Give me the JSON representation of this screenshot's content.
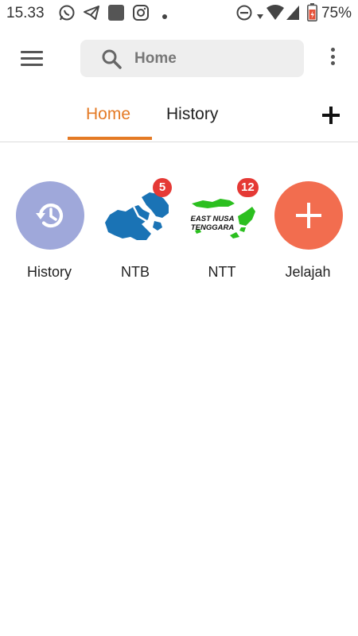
{
  "status_bar": {
    "time": "15.33",
    "battery": "75%",
    "icons": [
      "whatsapp-icon",
      "telegram-icon",
      "app-icon",
      "instagram-icon",
      "dot-icon",
      "dnd-icon",
      "data-arrow-icon",
      "wifi-icon",
      "signal-icon",
      "battery-icon"
    ]
  },
  "search": {
    "text": "Home"
  },
  "tabs": [
    {
      "label": "Home",
      "active": true
    },
    {
      "label": "History",
      "active": false
    }
  ],
  "shortcuts": [
    {
      "label": "History",
      "icon": "history-icon",
      "color": "#9fa8da"
    },
    {
      "label": "NTB",
      "icon": "ntb-map-icon",
      "badge": "5",
      "color": "#1a73b5"
    },
    {
      "label": "NTT",
      "icon": "ntt-map-icon",
      "badge": "12",
      "map_text": "EAST NUSA TENGGARA",
      "color": "#2bbf1f"
    },
    {
      "label": "Jelajah",
      "icon": "add-icon",
      "color": "#f26d4f"
    }
  ],
  "colors": {
    "accent": "#e47a25",
    "badge": "#e53935"
  }
}
